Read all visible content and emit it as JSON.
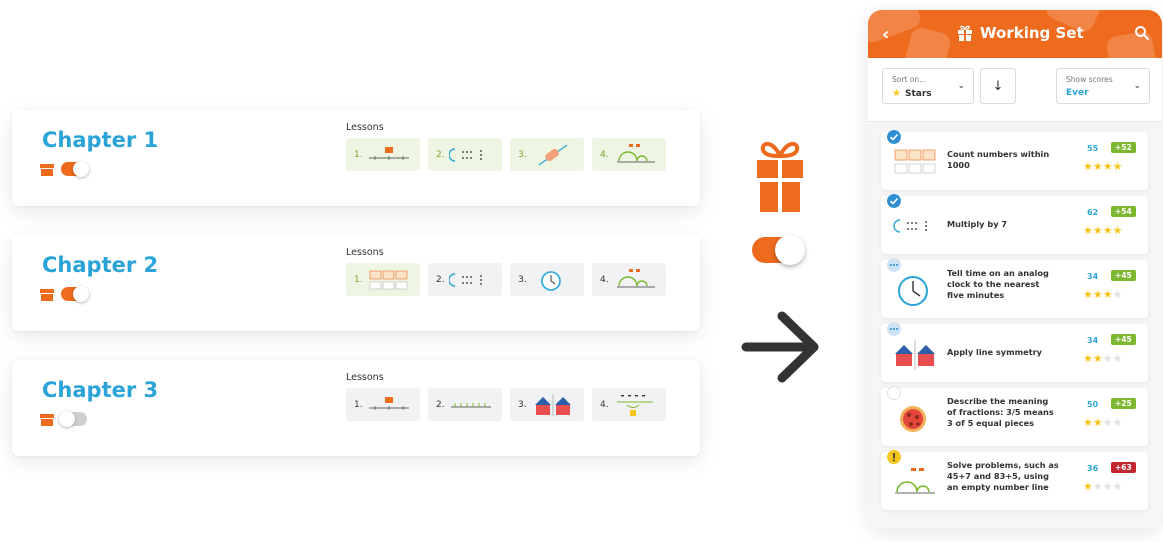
{
  "chapters": [
    {
      "title": "Chapter 1",
      "toggle": "on",
      "lessons_label": "Lessons",
      "lessons": [
        {
          "num": "1.",
          "bg": "green"
        },
        {
          "num": "2.",
          "bg": "green"
        },
        {
          "num": "3.",
          "bg": "green"
        },
        {
          "num": "4.",
          "bg": "green"
        }
      ]
    },
    {
      "title": "Chapter 2",
      "toggle": "on",
      "lessons_label": "Lessons",
      "lessons": [
        {
          "num": "1.",
          "bg": "green"
        },
        {
          "num": "2.",
          "bg": "gray"
        },
        {
          "num": "3.",
          "bg": "gray"
        },
        {
          "num": "4.",
          "bg": "gray"
        }
      ]
    },
    {
      "title": "Chapter 3",
      "toggle": "off",
      "lessons_label": "Lessons",
      "lessons": [
        {
          "num": "1.",
          "bg": "gray"
        },
        {
          "num": "2.",
          "bg": "gray"
        },
        {
          "num": "3.",
          "bg": "gray"
        },
        {
          "num": "4.",
          "bg": "gray"
        }
      ]
    }
  ],
  "phone": {
    "header": {
      "back_icon": "chevron-left-icon",
      "title": "Working Set",
      "search_icon": "search-icon"
    },
    "sort": {
      "label": "Sort on...",
      "value": "Stars",
      "chevron": "⌄"
    },
    "direction_icon": "↓",
    "scores": {
      "label": "Show scores",
      "value": "Ever",
      "chevron": "⌄"
    },
    "items": [
      {
        "title": "Count numbers within 1000",
        "score": "55",
        "delta": "+52",
        "delta_color": "#7cb82f",
        "stars": 4,
        "status": "done"
      },
      {
        "title": "Multiply by 7",
        "score": "62",
        "delta": "+54",
        "delta_color": "#7cb82f",
        "stars": 4,
        "status": "done"
      },
      {
        "title": "Tell time on an analog clock to the nearest five minutes",
        "score": "34",
        "delta": "+45",
        "delta_color": "#7cb82f",
        "stars": 3,
        "status": "progress"
      },
      {
        "title": "Apply line symmetry",
        "score": "34",
        "delta": "+45",
        "delta_color": "#7cb82f",
        "stars": 2,
        "status": "progress"
      },
      {
        "title": "Describe the meaning of fractions: 3/5 means 3 of 5 equal pieces",
        "score": "50",
        "delta": "+25",
        "delta_color": "#7cb82f",
        "stars": 2,
        "status": "none"
      },
      {
        "title": "Solve problems, such as 45+7 and 83+5, using an empty number line",
        "score": "36",
        "delta": "+63",
        "delta_color": "#c0282d",
        "stars": 1,
        "status": "warning"
      }
    ]
  },
  "colors": {
    "accent": "#ee6b1e",
    "chapter_title": "#2aa4d8",
    "star": "#f6c519"
  }
}
